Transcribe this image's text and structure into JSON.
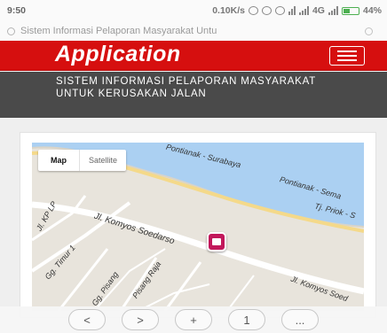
{
  "status_bar": {
    "time": "9:50",
    "speed": "0.10K/s",
    "network": "4G",
    "battery": "44%"
  },
  "url_bar": {
    "text": "Sistem Informasi Pelaporan Masyarakat Untu"
  },
  "app_header": {
    "title": "Application",
    "brand_color": "#d60f0f"
  },
  "banner": {
    "text": "SISTEM INFORMASI PELAPORAN MASYARAKAT UNTUK KERUSAKAN JALAN"
  },
  "map": {
    "map_type_buttons": [
      "Map",
      "Satellite"
    ],
    "selected": "Map",
    "labels": {
      "road_top": "Pontianak - Surabaya",
      "road_top2": "Pontianak - Sema",
      "road_right": "Tj. Priok - S",
      "komyos": "Jl. Komyos Soedarso",
      "kp": "Jl. KP LP",
      "timur": "Gg. Timur 1",
      "pisang": "Gg. Pisang",
      "raja": "Pisang Raja",
      "komyos2": "Jl. Komyos Soed"
    },
    "marker_icon": "report-pin-icon"
  },
  "bottom_nav": {
    "back": "<",
    "forward": ">",
    "new_tab": "+",
    "tabs": "1",
    "more": "..."
  }
}
